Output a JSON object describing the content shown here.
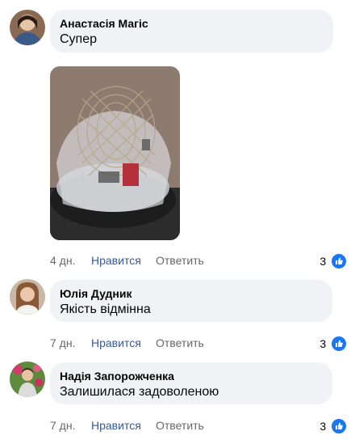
{
  "comments": [
    {
      "author": "Анастасія Магіс",
      "text": "Супер",
      "time": "4 дн.",
      "like_label": "Нравится",
      "reply_label": "Ответить",
      "reaction_count": "3",
      "reaction_icon": "like-icon",
      "has_photo": true
    },
    {
      "author": "Юлія Дудник",
      "text": "Якість відмінна",
      "time": "7 дн.",
      "like_label": "Нравится",
      "reply_label": "Ответить",
      "reaction_count": "3",
      "reaction_icon": "like-icon"
    },
    {
      "author": "Надія Запорожченка",
      "text": "Залишилася задоволеною",
      "time": "7 дн.",
      "like_label": "Нравится",
      "reply_label": "Ответить",
      "reaction_count": "3",
      "reaction_icon": "like-icon"
    }
  ],
  "colors": {
    "bubble_bg": "#f0f2f5",
    "link": "#385898",
    "meta": "#65676b",
    "like_badge": "#1877f2"
  }
}
